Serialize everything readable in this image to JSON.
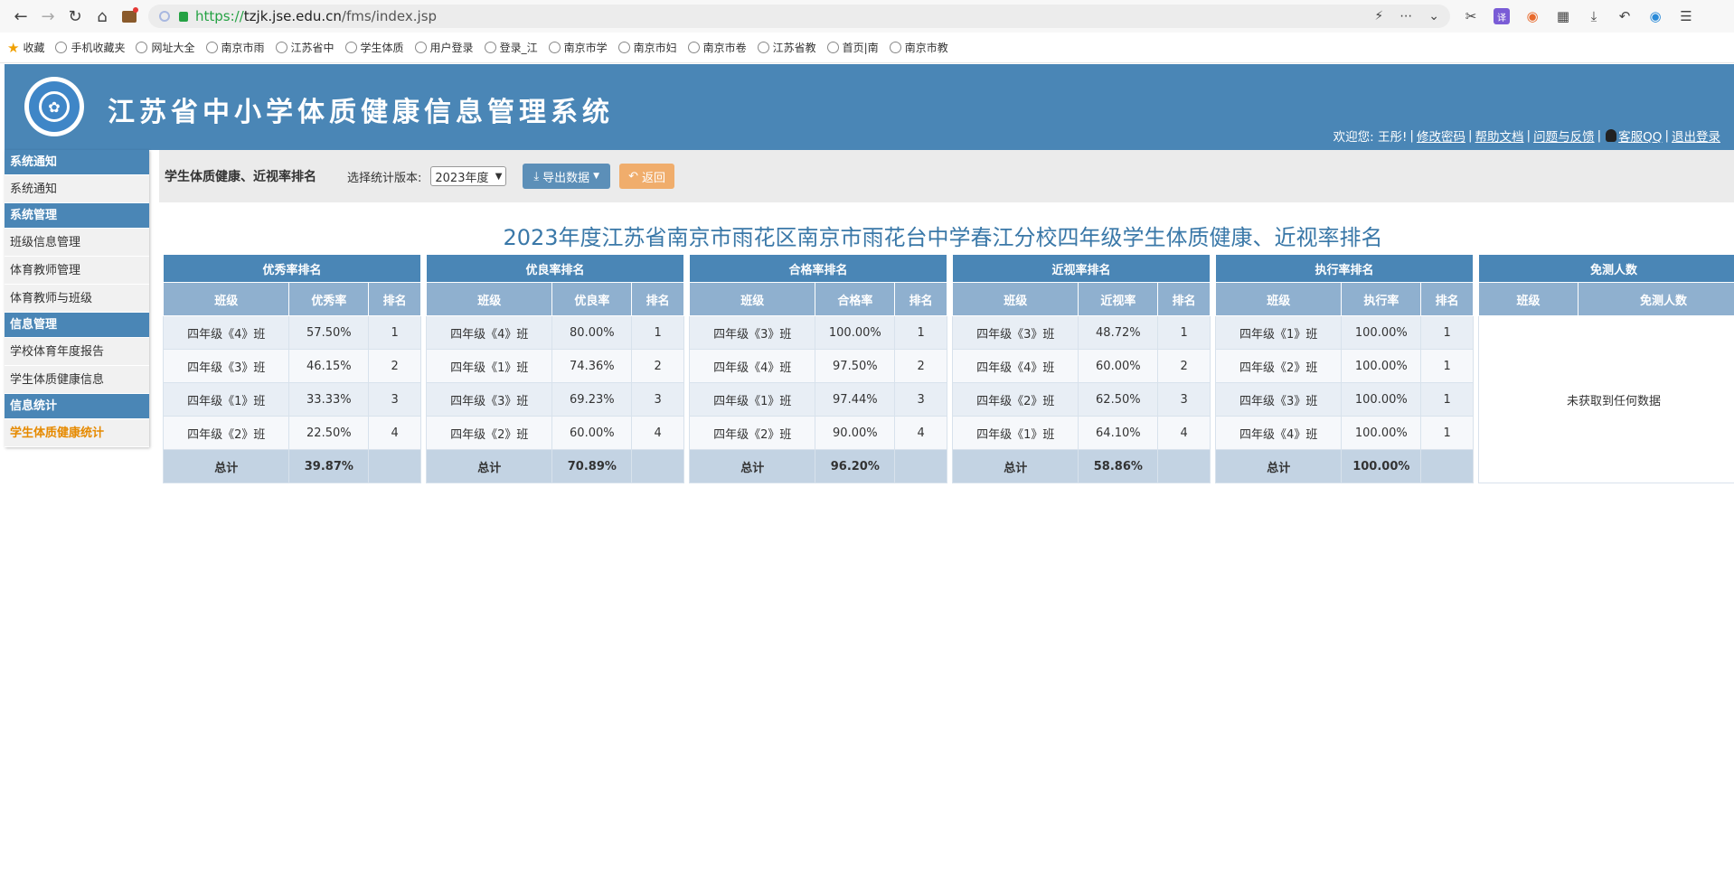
{
  "browser": {
    "url_scheme": "https://",
    "url_host": "tzjk.jse.edu.cn",
    "url_path": "/fms/index.jsp",
    "bookmarks": [
      "收藏",
      "手机收藏夹",
      "网址大全",
      "南京市雨",
      "江苏省中",
      "学生体质",
      "用户登录",
      "登录_江",
      "南京市学",
      "南京市妇",
      "南京市卷",
      "江苏省教",
      "首页|南",
      "南京市教"
    ]
  },
  "header": {
    "title": "江苏省中小学体质健康信息管理系统",
    "welcome": "欢迎您: 王彤!",
    "links": [
      "修改密码",
      "帮助文档",
      "问题与反馈",
      "客服QQ",
      "退出登录"
    ]
  },
  "sidebar": {
    "sections": [
      {
        "title": "系统通知",
        "items": [
          "系统通知"
        ]
      },
      {
        "title": "系统管理",
        "items": [
          "班级信息管理",
          "体育教师管理",
          "体育教师与班级"
        ]
      },
      {
        "title": "信息管理",
        "items": [
          "学校体育年度报告",
          "学生体质健康信息"
        ]
      },
      {
        "title": "信息统计",
        "items": [
          "学生体质健康统计"
        ]
      }
    ]
  },
  "content": {
    "page_title": "学生体质健康、近视率排名",
    "version_label": "选择统计版本:",
    "version_value": "2023年度",
    "export_label": "导出数据",
    "back_label": "返回",
    "report_title": "2023年度江苏省南京市雨花区南京市雨花台中学春江分校四年级学生体质健康、近视率排名"
  },
  "tables": [
    {
      "title": "优秀率排名",
      "headers": [
        "班级",
        "优秀率",
        "排名"
      ],
      "rows": [
        [
          "四年级《4》班",
          "57.50%",
          "1"
        ],
        [
          "四年级《3》班",
          "46.15%",
          "2"
        ],
        [
          "四年级《1》班",
          "33.33%",
          "3"
        ],
        [
          "四年级《2》班",
          "22.50%",
          "4"
        ]
      ],
      "total": [
        "总计",
        "39.87%",
        ""
      ]
    },
    {
      "title": "优良率排名",
      "headers": [
        "班级",
        "优良率",
        "排名"
      ],
      "rows": [
        [
          "四年级《4》班",
          "80.00%",
          "1"
        ],
        [
          "四年级《1》班",
          "74.36%",
          "2"
        ],
        [
          "四年级《3》班",
          "69.23%",
          "3"
        ],
        [
          "四年级《2》班",
          "60.00%",
          "4"
        ]
      ],
      "total": [
        "总计",
        "70.89%",
        ""
      ]
    },
    {
      "title": "合格率排名",
      "headers": [
        "班级",
        "合格率",
        "排名"
      ],
      "rows": [
        [
          "四年级《3》班",
          "100.00%",
          "1"
        ],
        [
          "四年级《4》班",
          "97.50%",
          "2"
        ],
        [
          "四年级《1》班",
          "97.44%",
          "3"
        ],
        [
          "四年级《2》班",
          "90.00%",
          "4"
        ]
      ],
      "total": [
        "总计",
        "96.20%",
        ""
      ]
    },
    {
      "title": "近视率排名",
      "headers": [
        "班级",
        "近视率",
        "排名"
      ],
      "rows": [
        [
          "四年级《3》班",
          "48.72%",
          "1"
        ],
        [
          "四年级《4》班",
          "60.00%",
          "2"
        ],
        [
          "四年级《2》班",
          "62.50%",
          "3"
        ],
        [
          "四年级《1》班",
          "64.10%",
          "4"
        ]
      ],
      "total": [
        "总计",
        "58.86%",
        ""
      ]
    },
    {
      "title": "执行率排名",
      "headers": [
        "班级",
        "执行率",
        "排名"
      ],
      "rows": [
        [
          "四年级《1》班",
          "100.00%",
          "1"
        ],
        [
          "四年级《2》班",
          "100.00%",
          "1"
        ],
        [
          "四年级《3》班",
          "100.00%",
          "1"
        ],
        [
          "四年级《4》班",
          "100.00%",
          "1"
        ]
      ],
      "total": [
        "总计",
        "100.00%",
        ""
      ]
    }
  ],
  "exempt": {
    "title": "免测人数",
    "headers": [
      "班级",
      "免测人数"
    ],
    "empty_text": "未获取到任何数据"
  }
}
